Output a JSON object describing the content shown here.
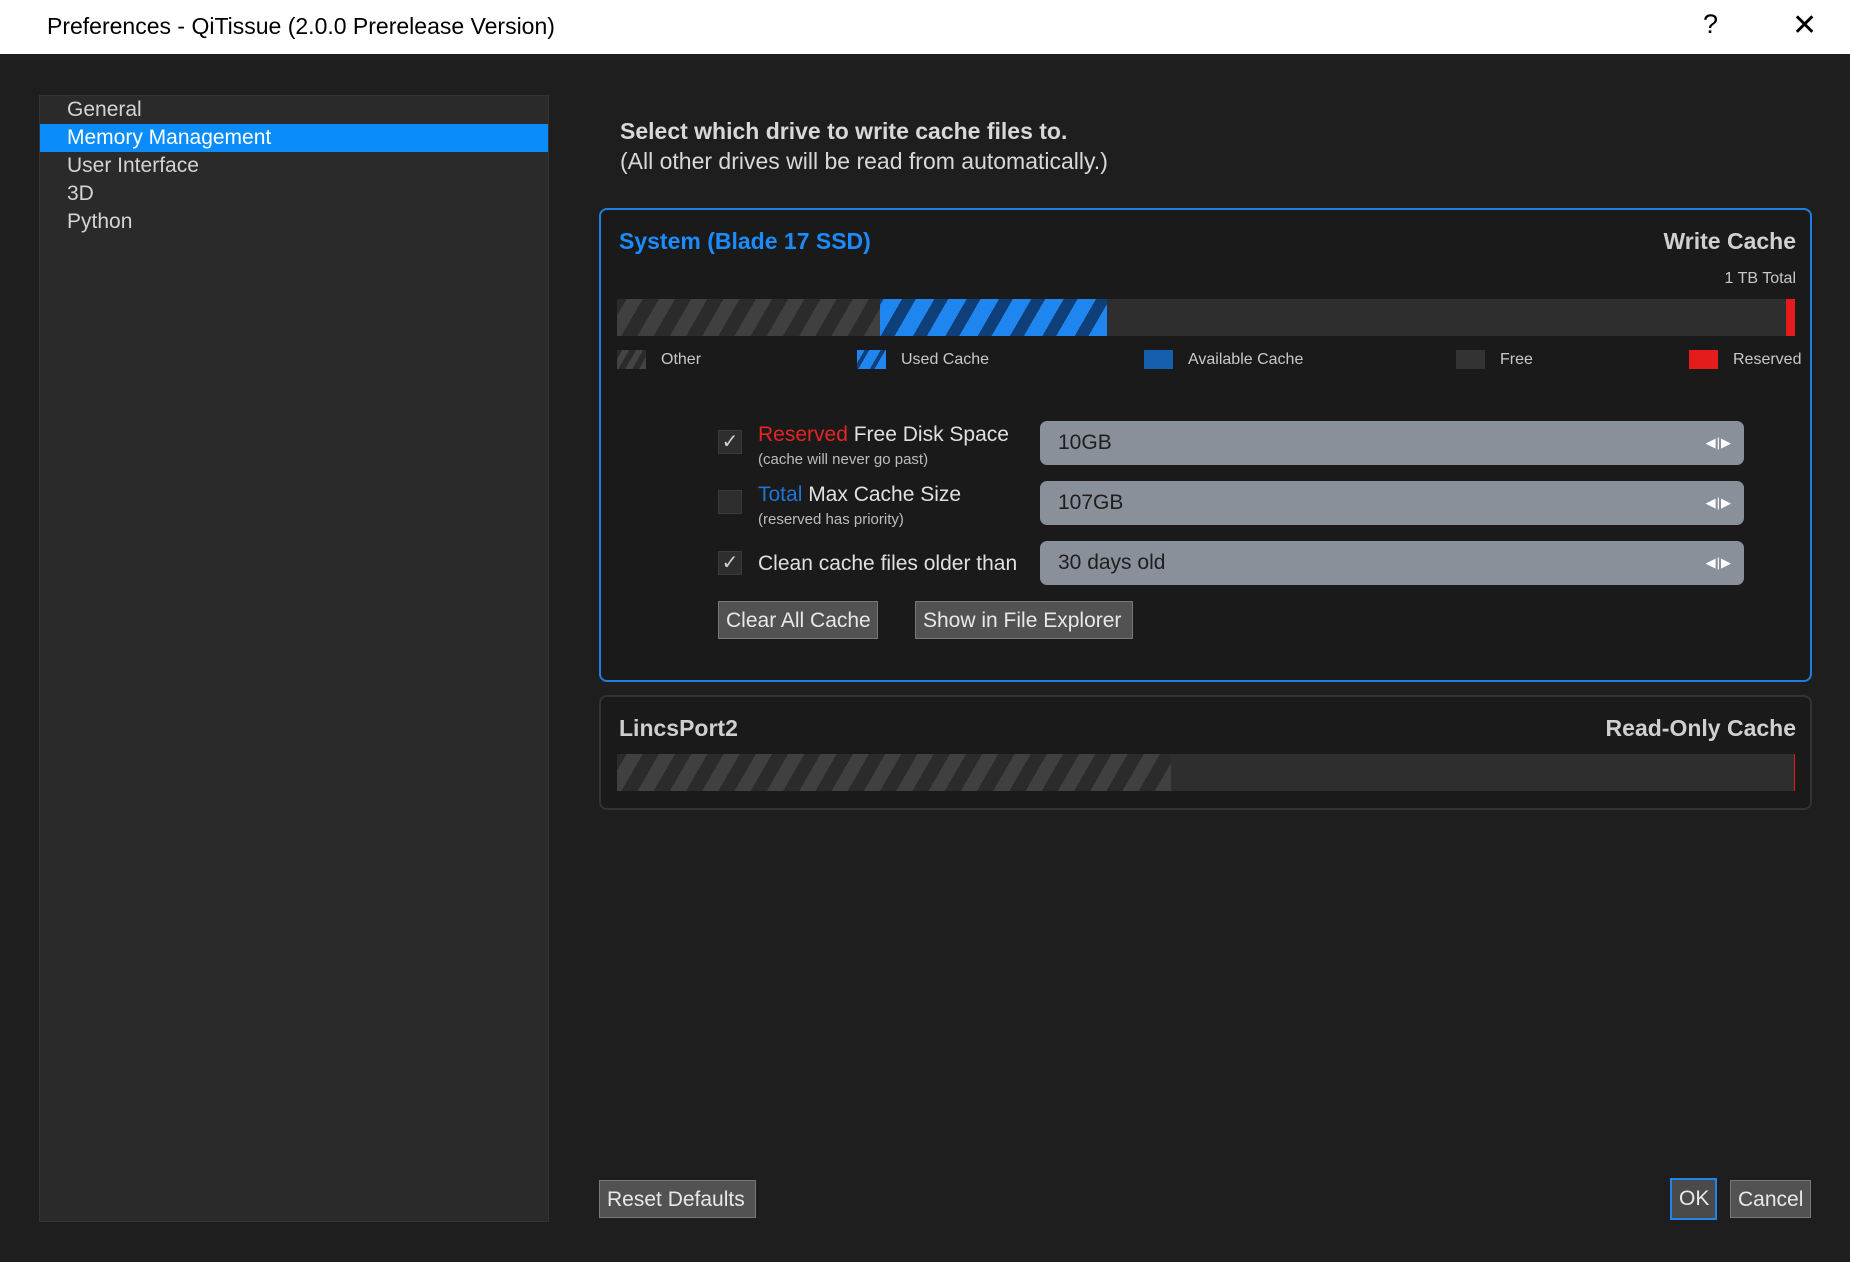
{
  "window": {
    "title": "Preferences - QiTissue (2.0.0 Prerelease Version)",
    "help_label": "?",
    "close_label": "✕"
  },
  "sidebar": {
    "items": [
      {
        "label": "General"
      },
      {
        "label": "Memory Management",
        "selected": true
      },
      {
        "label": "User Interface"
      },
      {
        "label": "3D"
      },
      {
        "label": "Python"
      }
    ]
  },
  "intro": {
    "line1": "Select which drive to write cache files to.",
    "line2": "(All other drives will be read from automatically.)"
  },
  "drives": [
    {
      "name": "System (Blade 17 SSD)",
      "cache_type": "Write Cache",
      "total": "1 TB Total",
      "usage_fractions": {
        "other": 0.223,
        "used_cache": 0.193,
        "available_cache": 0.0,
        "free": 0.576,
        "reserved": 0.008
      },
      "legend": {
        "other": "Other",
        "used_cache": "Used Cache",
        "available_cache": "Available Cache",
        "free": "Free",
        "reserved": "Reserved"
      },
      "options": {
        "reserved": {
          "checked": true,
          "check_glyph": "✓",
          "label_highlight": "Reserved",
          "label_rest": " Free Disk Space",
          "sublabel": "(cache will never go past)",
          "value": "10GB"
        },
        "total": {
          "checked": false,
          "check_glyph": "",
          "label_highlight": "Total",
          "label_rest": " Max Cache Size",
          "sublabel": "(reserved has priority)",
          "value": "107GB"
        },
        "clean": {
          "checked": true,
          "check_glyph": "✓",
          "label": "Clean cache files older than",
          "value": "30 days old"
        }
      },
      "spin_arrows": "◀|▶",
      "buttons": {
        "clear": "Clear All Cache",
        "explorer": "Show in File Explorer"
      }
    },
    {
      "name": "LincsPort2",
      "cache_type": "Read-Only Cache",
      "usage_fractions": {
        "other": 0.47,
        "free": 0.529,
        "reserved": 0.001
      }
    }
  ],
  "footer": {
    "reset": "Reset Defaults",
    "ok": "OK",
    "cancel": "Cancel"
  },
  "colors": {
    "accent": "#0a8dfa",
    "reserved": "#e51c1c",
    "used_cache": "#1f86f0"
  }
}
